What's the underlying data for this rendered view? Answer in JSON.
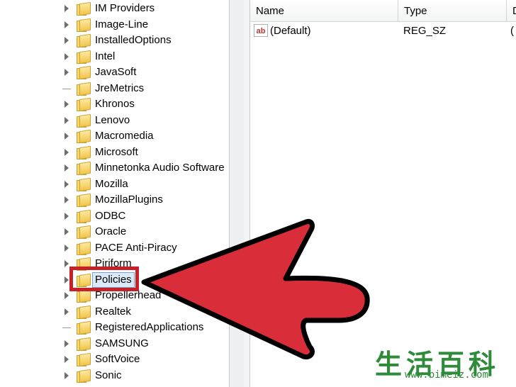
{
  "tree": {
    "items": [
      {
        "label": "IM Providers",
        "expandable": true
      },
      {
        "label": "Image-Line",
        "expandable": true
      },
      {
        "label": "InstalledOptions",
        "expandable": true
      },
      {
        "label": "Intel",
        "expandable": true
      },
      {
        "label": "JavaSoft",
        "expandable": true
      },
      {
        "label": "JreMetrics",
        "expandable": false
      },
      {
        "label": "Khronos",
        "expandable": true
      },
      {
        "label": "Lenovo",
        "expandable": true
      },
      {
        "label": "Macromedia",
        "expandable": true
      },
      {
        "label": "Microsoft",
        "expandable": true
      },
      {
        "label": "Minnetonka Audio Software",
        "expandable": true
      },
      {
        "label": "Mozilla",
        "expandable": true
      },
      {
        "label": "MozillaPlugins",
        "expandable": true
      },
      {
        "label": "ODBC",
        "expandable": true
      },
      {
        "label": "Oracle",
        "expandable": true
      },
      {
        "label": "PACE Anti-Piracy",
        "expandable": true
      },
      {
        "label": "Piriform",
        "expandable": true
      },
      {
        "label": "Policies",
        "expandable": true,
        "selected": true
      },
      {
        "label": "Propellerhead",
        "expandable": true
      },
      {
        "label": "Realtek",
        "expandable": true
      },
      {
        "label": "RegisteredApplications",
        "expandable": false
      },
      {
        "label": "SAMSUNG",
        "expandable": true
      },
      {
        "label": "SoftVoice",
        "expandable": true
      },
      {
        "label": "Sonic",
        "expandable": true
      }
    ]
  },
  "list": {
    "columns": {
      "name": "Name",
      "type": "Type",
      "data": "D"
    },
    "rows": [
      {
        "icon": "ab",
        "name": "(Default)",
        "type": "REG_SZ",
        "data": "("
      }
    ]
  },
  "annotation": {
    "arrow_color": "#d92e3a",
    "highlight_color": "#c42228"
  },
  "watermark": {
    "chars": "生活百科",
    "url": "www.bimeiz.com"
  }
}
